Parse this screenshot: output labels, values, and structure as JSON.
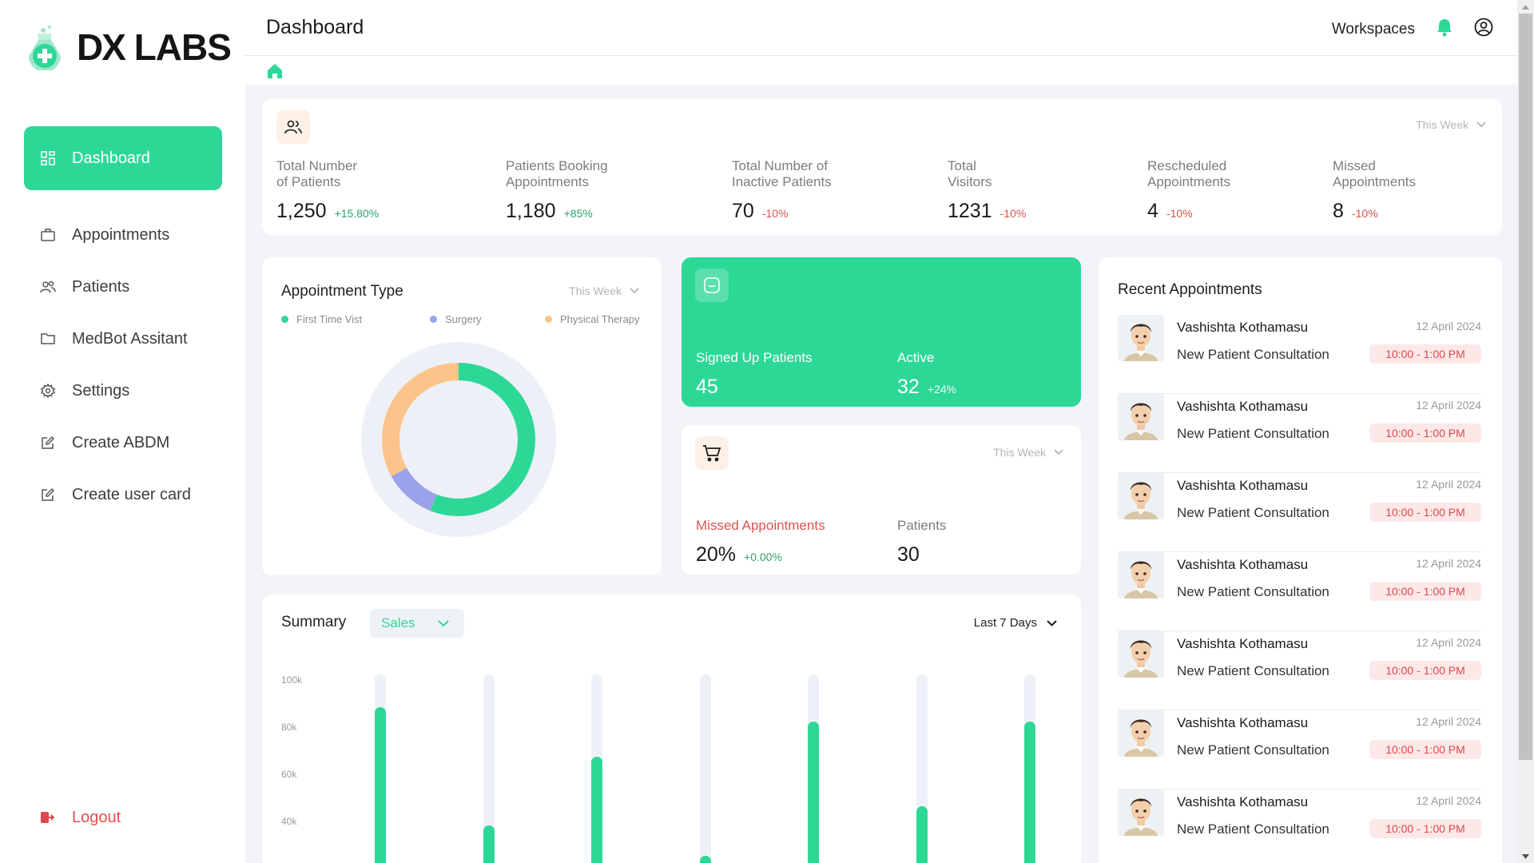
{
  "brand": {
    "name_part1": "DX",
    "name_part2": "LABS"
  },
  "sidebar": {
    "items": [
      {
        "label": "Dashboard",
        "icon": "grid-icon",
        "active": true
      },
      {
        "label": "Appointments",
        "icon": "briefcase-icon"
      },
      {
        "label": "Patients",
        "icon": "users-icon"
      },
      {
        "label": "MedBot Assitant",
        "icon": "folder-icon"
      },
      {
        "label": "Settings",
        "icon": "gear-icon"
      },
      {
        "label": "Create ABDM",
        "icon": "edit-icon"
      },
      {
        "label": "Create user card",
        "icon": "edit-icon"
      }
    ],
    "logout_label": "Logout"
  },
  "header": {
    "title": "Dashboard",
    "workspaces_label": "Workspaces",
    "icons": [
      "bell-icon",
      "user-circle-icon",
      "home-icon"
    ]
  },
  "stats": {
    "period": "This Week",
    "items": [
      {
        "label_line1": "Total Number",
        "label_line2": "of Patients",
        "value": "1,250",
        "change": "+15.80%",
        "direction": "up"
      },
      {
        "label_line1": "Patients Booking",
        "label_line2": "Appointments",
        "value": "1,180",
        "change": "+85%",
        "direction": "up"
      },
      {
        "label_line1": "Total Number of",
        "label_line2": "Inactive Patients",
        "value": "70",
        "change": "-10%",
        "direction": "down"
      },
      {
        "label_line1": "Total",
        "label_line2": "Visitors",
        "value": "1231",
        "change": "-10%",
        "direction": "down"
      },
      {
        "label_line1": "Rescheduled",
        "label_line2": "Appointments",
        "value": "4",
        "change": "-10%",
        "direction": "down"
      },
      {
        "label_line1": "Missed",
        "label_line2": "Appointments",
        "value": "8",
        "change": "-10%",
        "direction": "down"
      }
    ]
  },
  "appointment_type": {
    "title": "Appointment Type",
    "period": "This Week",
    "legend": [
      {
        "label": "First Time Vist",
        "color": "#2dd897"
      },
      {
        "label": "Surgery",
        "color": "#9aa3ea"
      },
      {
        "label": "Physical Therapy",
        "color": "#fcc48a"
      }
    ],
    "shares": [
      0.56,
      0.11,
      0.33
    ]
  },
  "signed_up": {
    "label": "Signed Up Patients",
    "value": "45",
    "active_label": "Active",
    "active_value": "32",
    "active_change": "+24%"
  },
  "missed": {
    "period": "This Week",
    "label": "Missed Appointments",
    "value": "20%",
    "change": "+0.00%",
    "patients_label": "Patients",
    "patients_value": "30"
  },
  "summary": {
    "title": "Summary",
    "metric": "Sales",
    "range": "Last 7 Days"
  },
  "chart_data": {
    "type": "bar",
    "title": "Summary",
    "yticks": [
      "100k",
      "80k",
      "60k",
      "40k"
    ],
    "ylim": [
      20000,
      100000
    ],
    "values": [
      88000,
      38000,
      67000,
      25000,
      82000,
      46000,
      82000
    ],
    "grid": false
  },
  "recent": {
    "title": "Recent Appointments",
    "items": [
      {
        "name": "Vashishta Kothamasu",
        "type": "New Patient Consultation",
        "date": "12 April 2024",
        "time": "10:00 - 1:00 PM"
      },
      {
        "name": "Vashishta Kothamasu",
        "type": "New Patient Consultation",
        "date": "12 April 2024",
        "time": "10:00 - 1:00 PM"
      },
      {
        "name": "Vashishta Kothamasu",
        "type": "New Patient Consultation",
        "date": "12 April 2024",
        "time": "10:00 - 1:00 PM"
      },
      {
        "name": "Vashishta Kothamasu",
        "type": "New Patient Consultation",
        "date": "12 April 2024",
        "time": "10:00 - 1:00 PM"
      },
      {
        "name": "Vashishta Kothamasu",
        "type": "New Patient Consultation",
        "date": "12 April 2024",
        "time": "10:00 - 1:00 PM"
      },
      {
        "name": "Vashishta Kothamasu",
        "type": "New Patient Consultation",
        "date": "12 April 2024",
        "time": "10:00 - 1:00 PM"
      },
      {
        "name": "Vashishta Kothamasu",
        "type": "New Patient Consultation",
        "date": "12 April 2024",
        "time": "10:00 - 1:00 PM"
      }
    ]
  },
  "colors": {
    "accent": "#2dd897",
    "positive": "#2fa36b",
    "negative": "#d9534f",
    "surface": "#f3f4f8"
  }
}
